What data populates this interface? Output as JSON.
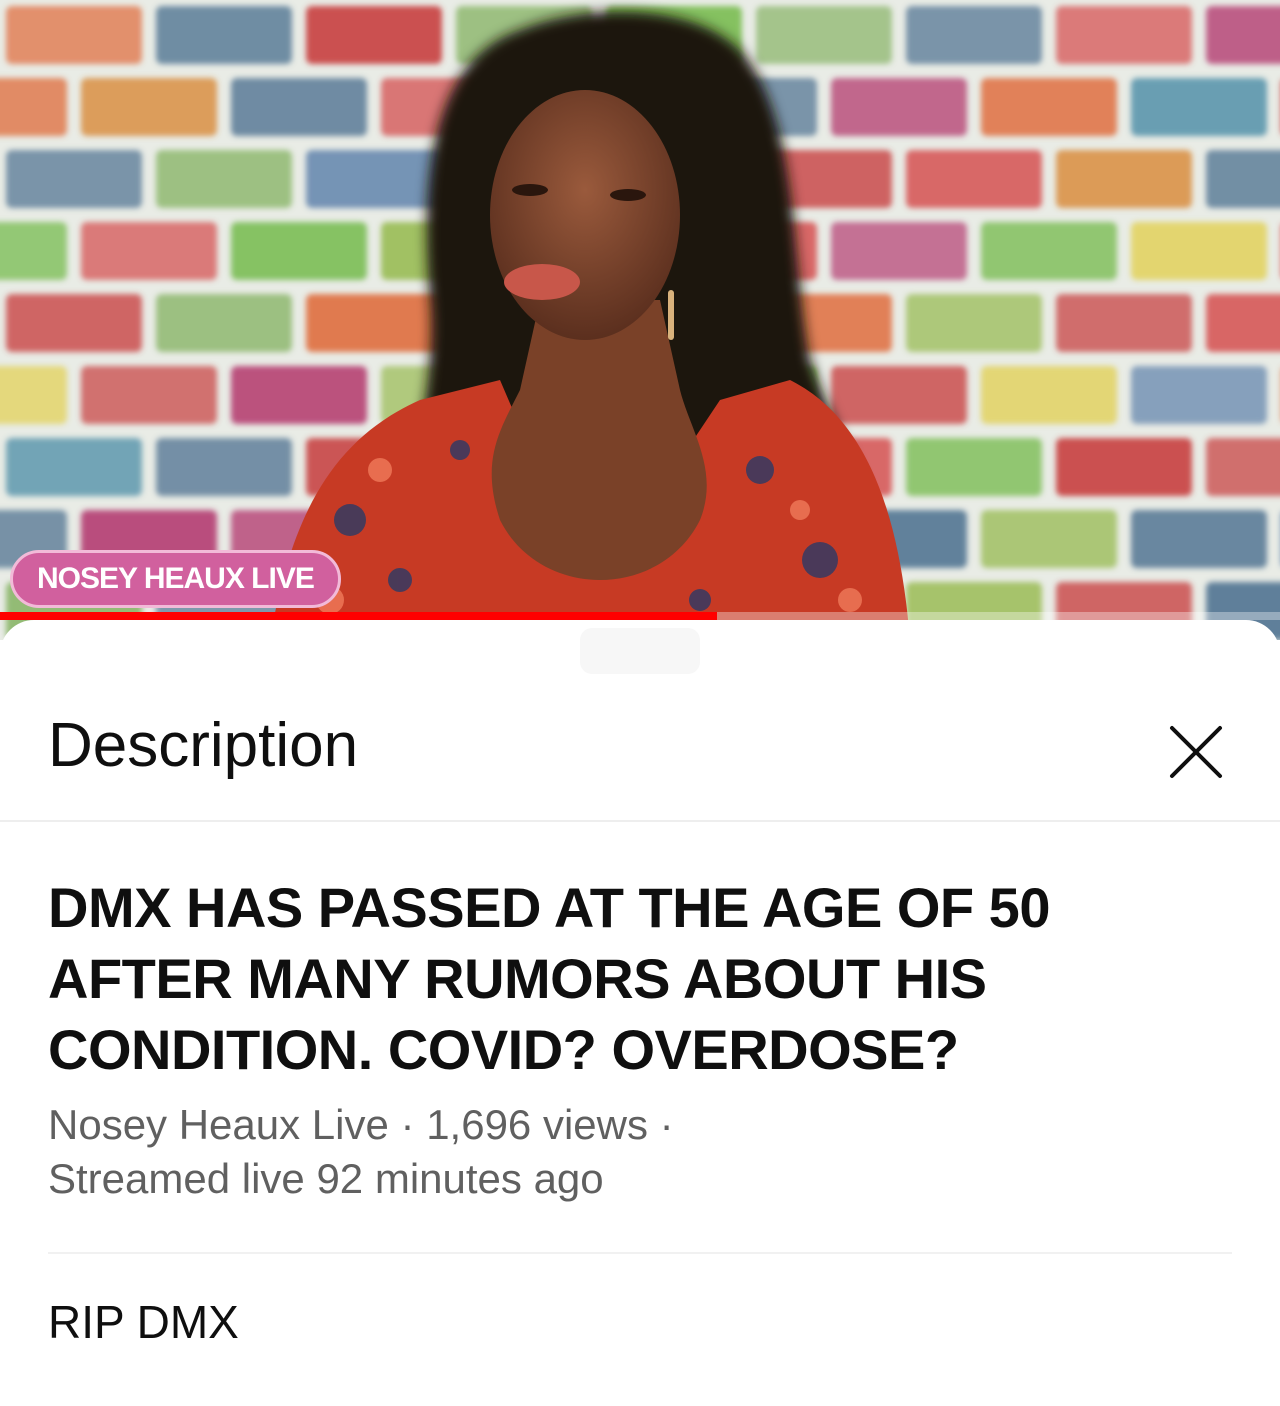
{
  "player": {
    "channel_tag": "NOSEY HEAUX LIVE",
    "progress": 0.56,
    "progress_color": "#ff0000",
    "tag_color": "#d1609e"
  },
  "sheet": {
    "title": "Description",
    "close_icon": "close-icon"
  },
  "video": {
    "title": "DMX HAS PASSED AT THE AGE OF 50 AFTER MANY RUMORS ABOUT HIS CONDITION. COVID? OVERDOSE?",
    "channel": "Nosey Heaux Live",
    "separator": "·",
    "views": "1,696 views",
    "streamed": "Streamed live 92 minutes ago",
    "description": "RIP DMX"
  }
}
